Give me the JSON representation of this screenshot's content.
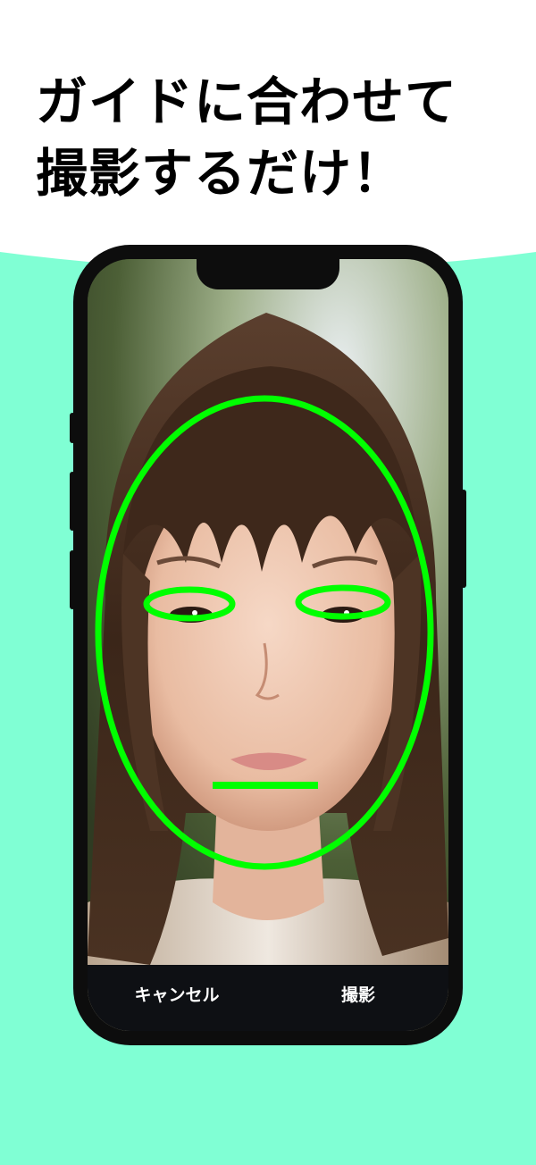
{
  "headline": {
    "line1": "ガイドに合わせて",
    "line2": "撮影するだけ！"
  },
  "controls": {
    "cancel_label": "キャンセル",
    "shoot_label": "撮影"
  },
  "colors": {
    "mint_background": "#80ffd4",
    "guide_green": "#00ff00",
    "phone_frame": "#0d0d0d",
    "control_bar": "#0e1014"
  },
  "icons": {
    "face_guide": "face-outline-guide-icon",
    "eye_guides": "eye-ellipse-guide-icon",
    "mouth_guide": "mouth-line-guide-icon"
  }
}
